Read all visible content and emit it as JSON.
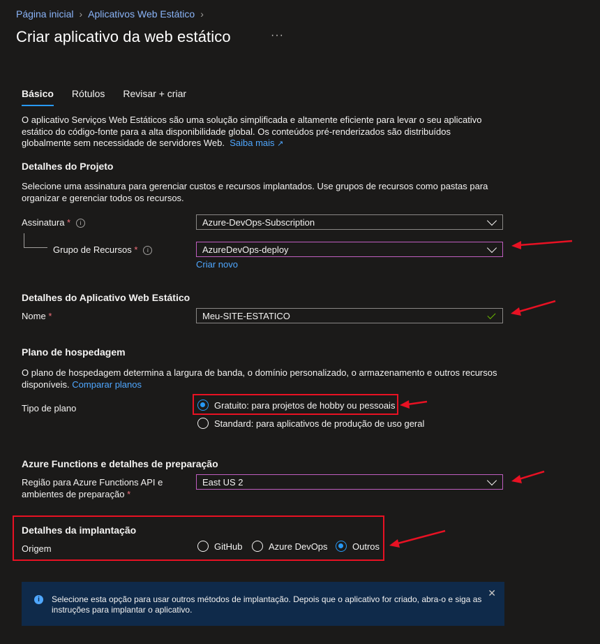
{
  "breadcrumb": [
    "Página inicial",
    "Aplicativos Web Estático"
  ],
  "page_title": "Criar aplicativo da web estático",
  "more_label": "···",
  "tabs": [
    "Básico",
    "Rótulos",
    "Revisar + criar"
  ],
  "intro": {
    "line1": "O aplicativo Serviços Web Estáticos são uma solução simplificada e altamente eficiente para levar o seu aplicativo",
    "line2": "estático do código-fonte para a alta disponibilidade global. Os conteúdos pré-renderizados são distribuídos",
    "line3": "globalmente sem necessidade de servidores Web.",
    "link": "Saiba mais"
  },
  "project": {
    "heading": "Detalhes do Projeto",
    "desc1": "Selecione uma assinatura para gerenciar custos e recursos implantados. Use grupos de recursos como pastas para",
    "desc2": "organizar e gerenciar todos os recursos.",
    "subscription_label": "Assinatura",
    "subscription_value": "Azure-DevOps-Subscription",
    "rg_label": "Grupo de Recursos",
    "rg_value": "AzureDevOps-deploy",
    "create_new": "Criar novo"
  },
  "app_details": {
    "heading": "Detalhes do Aplicativo Web Estático",
    "name_label": "Nome",
    "name_value": "Meu-SITE-ESTATICO"
  },
  "hosting": {
    "heading": "Plano de hospedagem",
    "desc1": "O plano de hospedagem determina a largura de banda, o domínio personalizado, o armazenamento e outros recursos",
    "desc2": "disponíveis.",
    "compare_link": "Comparar planos",
    "plan_label": "Tipo de plano",
    "options": [
      "Gratuito: para projetos de hobby ou pessoais",
      "Standard: para aplicativos de produção de uso geral"
    ],
    "selected": 0
  },
  "functions": {
    "heading": "Azure Functions e detalhes de preparação",
    "region_label_1": "Região para Azure Functions API e",
    "region_label_2": "ambientes de preparação",
    "region_value": "East US 2"
  },
  "deployment": {
    "heading": "Detalhes da implantação",
    "source_label": "Origem",
    "options": [
      "GitHub",
      "Azure DevOps",
      "Outros"
    ],
    "selected": 2
  },
  "banner": {
    "icon": "info-icon",
    "text": "Selecione esta opção para usar outros métodos de implantação. Depois que o aplicativo for criado, abra-o e siga as instruções para implantar o aplicativo.",
    "close": "✕"
  },
  "colors": {
    "accent": "#2899f5",
    "annotation_red": "#e81123",
    "highlight_border": "#c05ec0"
  }
}
